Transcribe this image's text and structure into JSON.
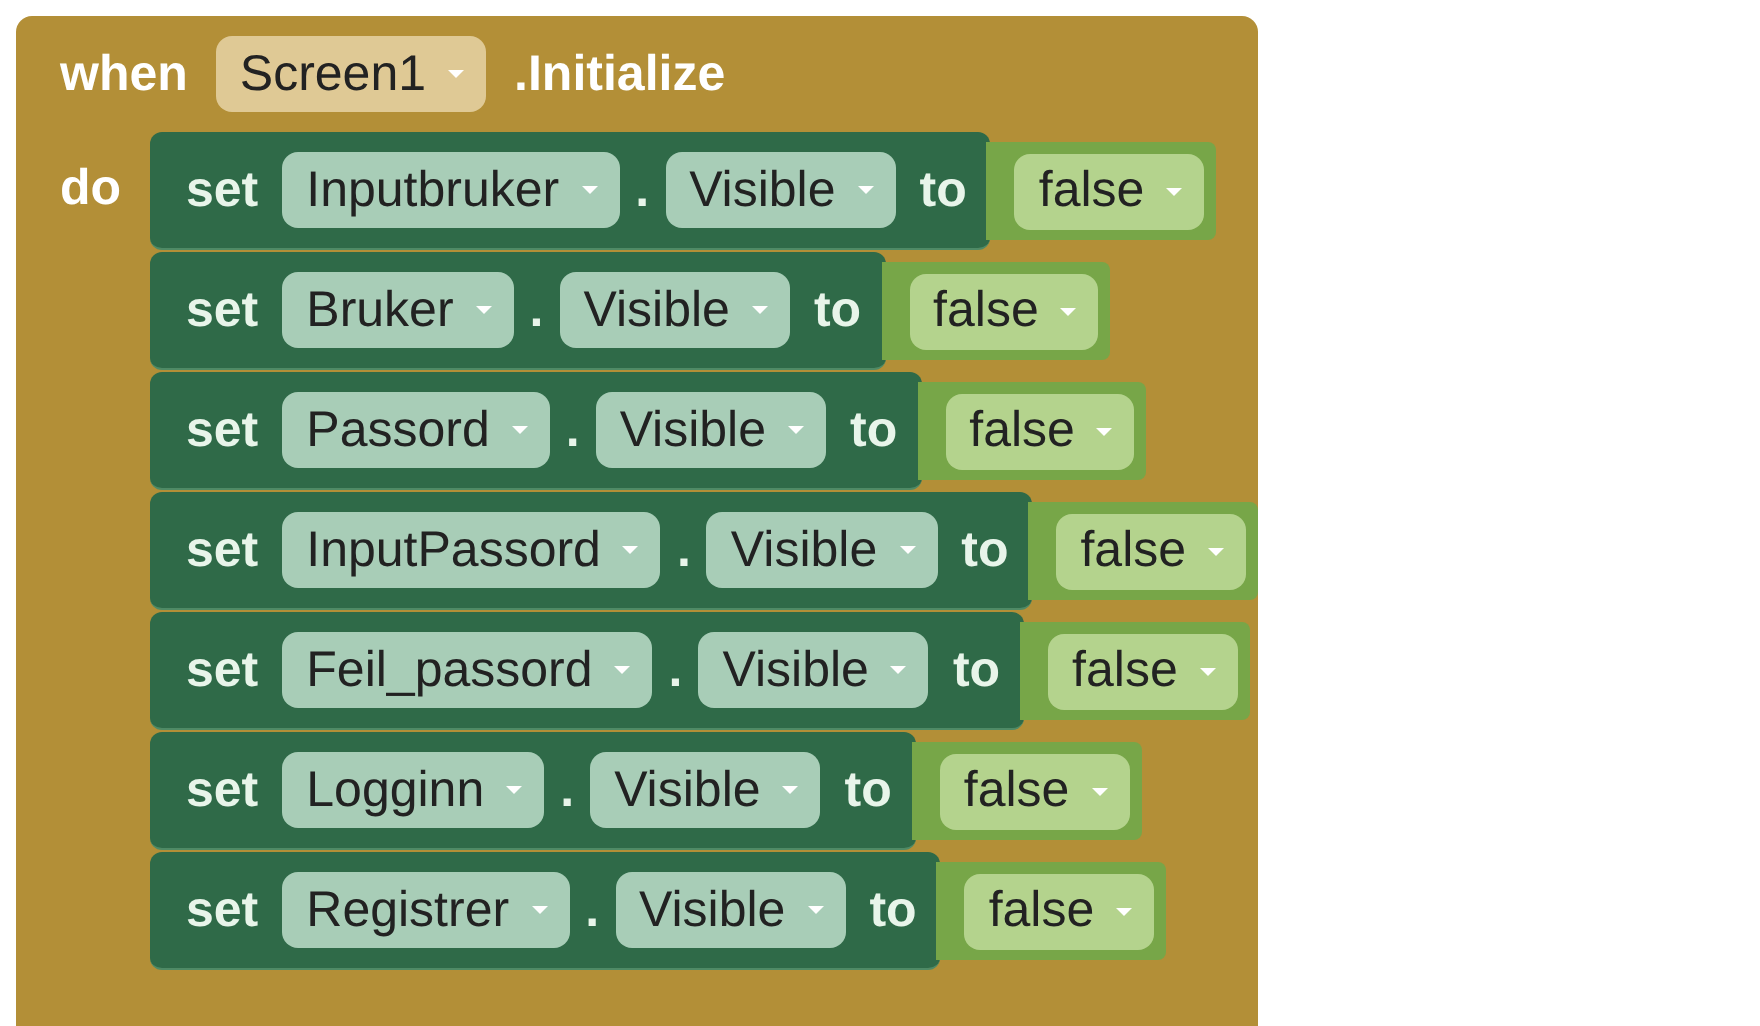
{
  "event_block": {
    "keyword": "when",
    "component": "Screen1",
    "event": ".Initialize",
    "do_label": "do"
  },
  "statements": [
    {
      "keyword": "set",
      "component": "Inputbruker",
      "dot": ".",
      "property": "Visible",
      "to": "to",
      "value": "false"
    },
    {
      "keyword": "set",
      "component": "Bruker",
      "dot": ".",
      "property": "Visible",
      "to": "to",
      "value": "false"
    },
    {
      "keyword": "set",
      "component": "Passord",
      "dot": ".",
      "property": "Visible",
      "to": "to",
      "value": "false"
    },
    {
      "keyword": "set",
      "component": "InputPassord",
      "dot": ".",
      "property": "Visible",
      "to": "to",
      "value": "false"
    },
    {
      "keyword": "set",
      "component": "Feil_passord",
      "dot": ".",
      "property": "Visible",
      "to": "to",
      "value": "false"
    },
    {
      "keyword": "set",
      "component": "Logginn",
      "dot": ".",
      "property": "Visible",
      "to": "to",
      "value": "false"
    },
    {
      "keyword": "set",
      "component": "Registrer",
      "dot": ".",
      "property": "Visible",
      "to": "to",
      "value": "false"
    }
  ]
}
